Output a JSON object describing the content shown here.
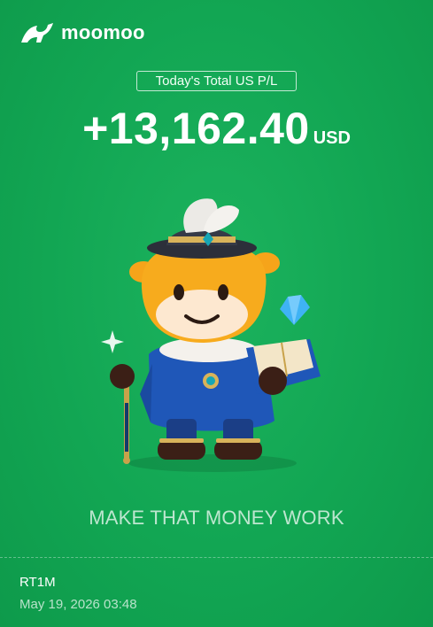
{
  "brand": {
    "name": "moomoo",
    "logo_icon": "bull-logo-icon"
  },
  "pl_card": {
    "label": "Today's Total US P/L",
    "amount": "+13,162.40",
    "currency": "USD"
  },
  "mascot": {
    "icon": "bull-mascot-illustration"
  },
  "tagline": "MAKE THAT MONEY WORK",
  "footer": {
    "user_id": "RT1M",
    "timestamp": "May 19, 2026 03:48"
  },
  "colors": {
    "background": "#12a653",
    "text": "#ffffff"
  }
}
